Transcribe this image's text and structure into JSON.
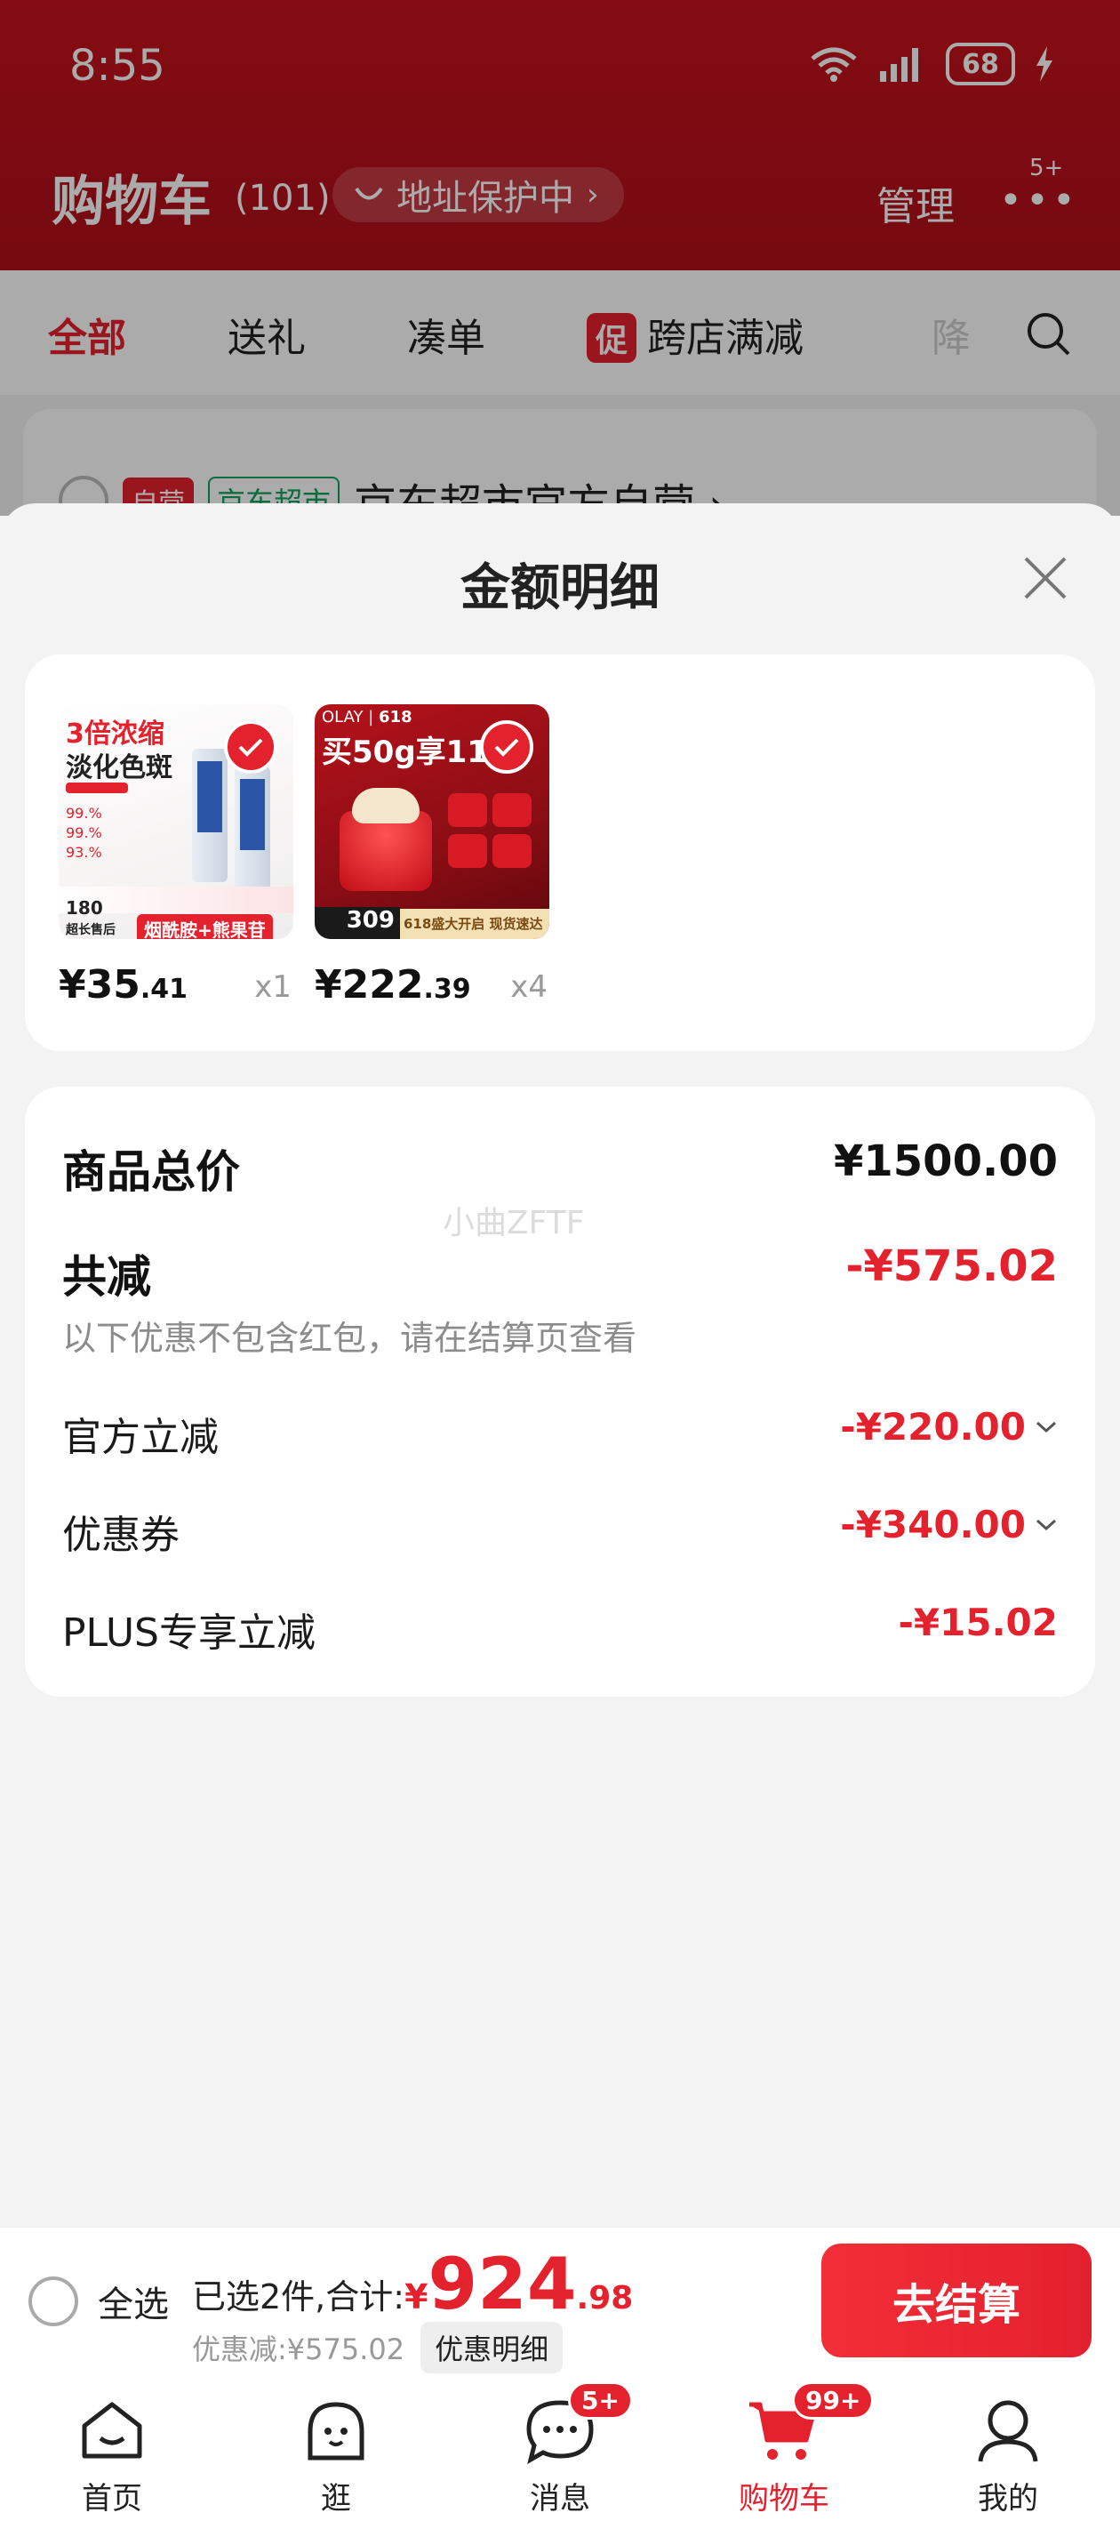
{
  "status_bar": {
    "time": "8:55",
    "battery": "68"
  },
  "header": {
    "title": "购物车",
    "count": "(101)",
    "address_protect": "地址保护中",
    "manage": "管理",
    "more_badge": "5+"
  },
  "filter_tabs": [
    {
      "label": "全部"
    },
    {
      "label": "送礼"
    },
    {
      "label": "凑单"
    },
    {
      "tag": "促",
      "label": "跨店满减"
    },
    {
      "label": "降"
    }
  ],
  "store": {
    "tag_self": "自营",
    "tag_market": "京东超市",
    "name": "京东超市官方自营 ›"
  },
  "sheet": {
    "title": "金额明细",
    "products": [
      {
        "price_int": "¥35",
        "price_dec": ".41",
        "qty": "x1"
      },
      {
        "price_int": "¥222",
        "price_dec": ".39",
        "qty": "x4"
      }
    ],
    "product1_image_text": {
      "line1": "3倍浓缩",
      "line2": "淡化色斑",
      "badge": "烟酰胺+熊果苷",
      "days": "180",
      "sub": "超长售后"
    },
    "product2_image_text": {
      "brand": "OLAY",
      "num": "618",
      "headline": "买50g享11",
      "price": "309",
      "tag": "618盛大开启 现货速达"
    },
    "summary": {
      "total_label": "商品总价",
      "total_value": "¥1500.00",
      "reduce_label": "共减",
      "reduce_value": "-¥575.02",
      "note": "以下优惠不包含红包，请在结算页查看",
      "watermark": "小曲ZFTF",
      "items": [
        {
          "label": "官方立减",
          "value": "-¥220.00"
        },
        {
          "label": "优惠券",
          "value": "-¥340.00"
        },
        {
          "label": "PLUS专享立减",
          "value": "-¥15.02"
        }
      ]
    }
  },
  "checkout": {
    "select_all": "全选",
    "selected_prefix": "已选2件,合计:",
    "total_symbol": "¥",
    "total_int": "924",
    "total_dec": ".98",
    "discount": "优惠减:¥575.02",
    "detail": "优惠明细",
    "button": "去结算"
  },
  "nav": [
    {
      "label": "首页"
    },
    {
      "label": "逛"
    },
    {
      "label": "消息",
      "badge": "5+"
    },
    {
      "label": "购物车",
      "badge": "99+"
    },
    {
      "label": "我的"
    }
  ],
  "colors": {
    "brand_red": "#e4222d",
    "header_red": "#c6121d"
  }
}
